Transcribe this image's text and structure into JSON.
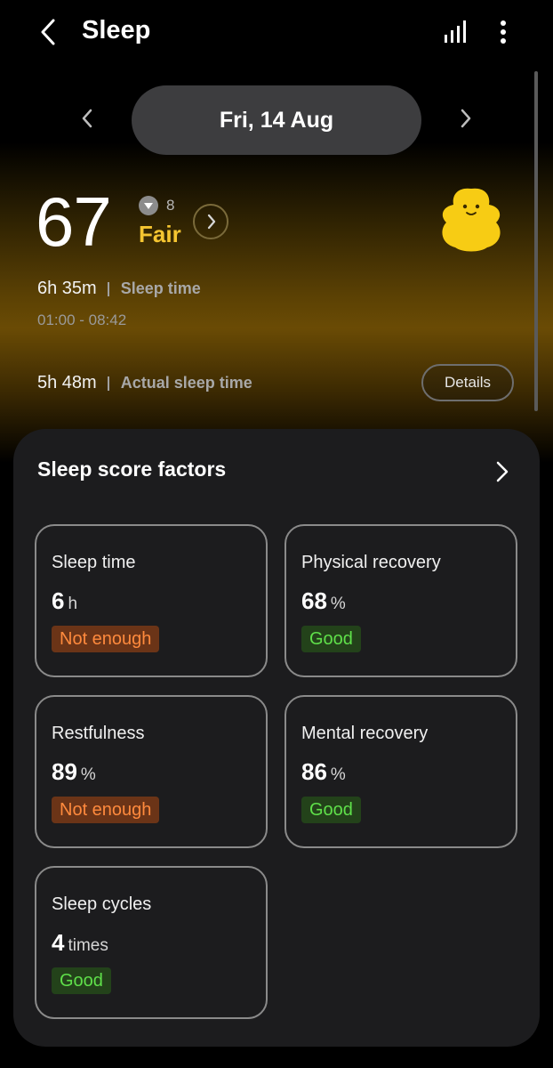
{
  "header": {
    "title": "Sleep",
    "icons": {
      "back": "back-arrow-icon",
      "stats": "bar-chart-icon",
      "more": "more-vert-icon"
    }
  },
  "date_nav": {
    "date": "Fri, 14 Aug",
    "prev_icon": "chevron-left-icon",
    "next_icon": "chevron-right-icon"
  },
  "summary": {
    "score": "67",
    "delta": "8",
    "delta_direction": "down",
    "rating": "Fair",
    "rating_color": "#f5c531",
    "sleep_time_value": "6h 35m",
    "sleep_time_label": "Sleep time",
    "time_range": "01:00 - 08:42",
    "actual_value": "5h 48m",
    "actual_label": "Actual sleep time",
    "details_label": "Details"
  },
  "factors": {
    "title": "Sleep score factors",
    "items": [
      {
        "label": "Sleep time",
        "value": "6",
        "unit": "h",
        "status": "Not enough",
        "status_type": "bad"
      },
      {
        "label": "Physical recovery",
        "value": "68",
        "unit": "%",
        "status": "Good",
        "status_type": "good"
      },
      {
        "label": "Restfulness",
        "value": "89",
        "unit": "%",
        "status": "Not enough",
        "status_type": "bad"
      },
      {
        "label": "Mental recovery",
        "value": "86",
        "unit": "%",
        "status": "Good",
        "status_type": "good"
      },
      {
        "label": "Sleep cycles",
        "value": "4",
        "unit": "times",
        "status": "Good",
        "status_type": "good"
      }
    ]
  },
  "colors": {
    "accent_yellow": "#f5c531",
    "bad": "#ff8a3d",
    "good": "#5fe04a",
    "card_bg": "#1c1c1e"
  }
}
